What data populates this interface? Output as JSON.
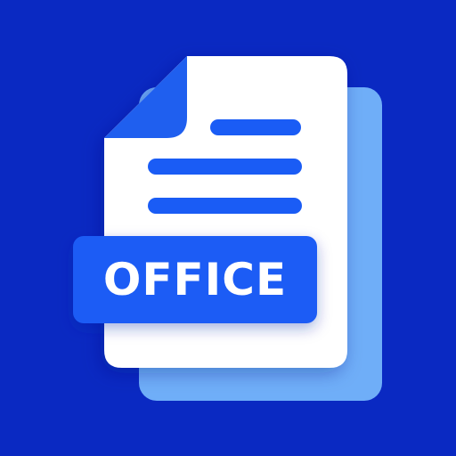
{
  "app_icon": {
    "label": "OFFICE",
    "icon_name": "office-document-icon"
  },
  "colors": {
    "background": "#0A29C2",
    "document": "#FFFFFF",
    "back_sheet": "#6FAEF8",
    "accent": "#1A5CF5",
    "fold": "#1F5FEF",
    "label_text": "#FFFFFF"
  }
}
